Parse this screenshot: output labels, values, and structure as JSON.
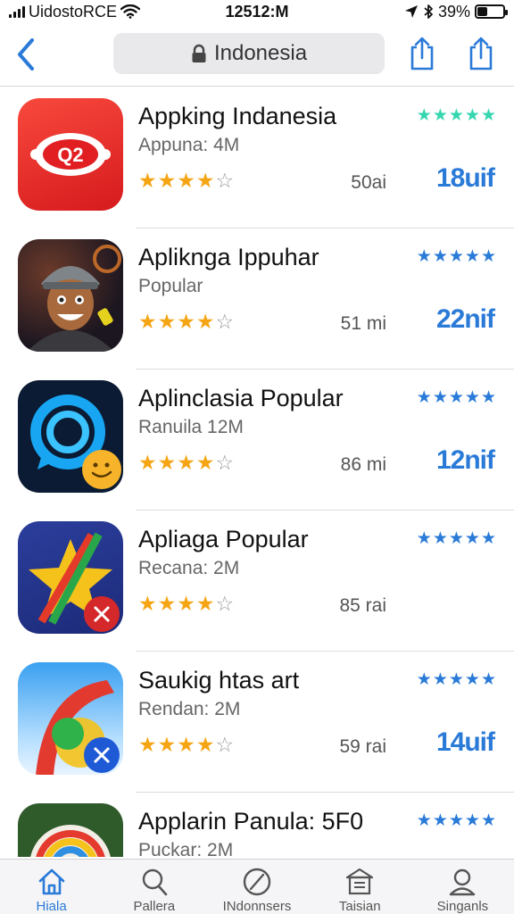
{
  "status_bar": {
    "carrier": "UidostoRCE",
    "time": "12512:M",
    "battery_text": "39%",
    "battery_level": 0.39
  },
  "nav": {
    "url_text": "Indonesia",
    "back_icon": "chevron-left-icon",
    "lock_icon": "lock-icon",
    "share_icon": "share-icon"
  },
  "apps": [
    {
      "name": "Appking Indanesia",
      "subtitle": "Appuna: 4M",
      "stars": 4,
      "meta": "50ai",
      "price": "18uif",
      "rating_star_color": "#35d6b0",
      "icon_text": "Q2"
    },
    {
      "name": "Aplikngа Ippuhar",
      "subtitle": "Popular",
      "stars": 4,
      "meta": "51 mi",
      "price": "22nif",
      "rating_star_color": "#2a7ad8"
    },
    {
      "name": "Aplinclasia Popular",
      "subtitle": "Ranuila 12M",
      "stars": 4,
      "meta": "86 mi",
      "price": "12nif",
      "rating_star_color": "#2a7ad8"
    },
    {
      "name": "Apliaga Popular",
      "subtitle": "Recana: 2M",
      "stars": 4,
      "meta": "85 rai",
      "price": "",
      "rating_star_color": "#2a7ad8"
    },
    {
      "name": "Saukig htas art",
      "subtitle": "Rendan: 2M",
      "stars": 4,
      "meta": "59 rai",
      "price": "14uif",
      "rating_star_color": "#2a7ad8"
    },
    {
      "name": "Applarin Panula: 5F0",
      "subtitle": "Puckar: 2M",
      "stars": 4,
      "meta": "",
      "price": "",
      "rating_star_color": "#2a7ad8"
    }
  ],
  "tabs": [
    {
      "label": "Hiala",
      "icon": "home-icon",
      "active": true
    },
    {
      "label": "Pallera",
      "icon": "search-icon",
      "active": false
    },
    {
      "label": "INdonnsers",
      "icon": "compass-icon",
      "active": false
    },
    {
      "label": "Taisian",
      "icon": "store-icon",
      "active": false
    },
    {
      "label": "Singanls",
      "icon": "profile-icon",
      "active": false
    }
  ],
  "colors": {
    "accent": "#2a7ad8",
    "star_orange": "#f5a514",
    "star_teal": "#35d6b0"
  }
}
